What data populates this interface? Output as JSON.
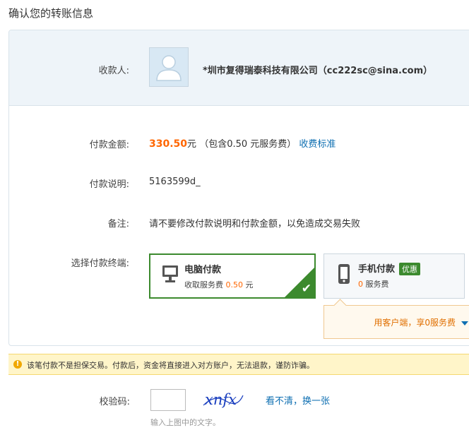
{
  "page": {
    "title": "确认您的转账信息"
  },
  "payee": {
    "label": "收款人:",
    "name": "*圳市复得瑞泰科技有限公司（cc222sc@sina.com）"
  },
  "amount": {
    "label": "付款金额:",
    "value": "330.50",
    "unit": "元",
    "fee_note": "（包含0.50 元服务费）",
    "fee_link": "收费标准"
  },
  "memo": {
    "label": "付款说明:",
    "value": "5163599d_"
  },
  "remark": {
    "label": "备注:",
    "value": "请不要修改付款说明和付款金额，以免造成交易失败"
  },
  "terminal": {
    "label": "选择付款终端:",
    "pc": {
      "title": "电脑付款",
      "sub_prefix": "收取服务费",
      "fee": "0.50",
      "sub_suffix": "元",
      "selected": true
    },
    "mobile": {
      "title": "手机付款",
      "badge": "优惠",
      "fee": "0",
      "sub_suffix": "服务费"
    },
    "tooltip": "用客户端，享0服务费"
  },
  "warning": {
    "icon": "!",
    "text": "该笔付款不是担保交易。付款后，资金将直接进入对方账户，无法退款，谨防诈骗。"
  },
  "captcha": {
    "label": "校验码:",
    "refresh_link": "看不清，换一张",
    "hint": "输入上图中的文字。",
    "image_text": "xnfx",
    "input_value": ""
  },
  "colors": {
    "accent_orange": "#ff6600",
    "link_blue": "#0e6fb2",
    "selected_green": "#3c8a2e",
    "warning_bg": "#fff5c9"
  }
}
